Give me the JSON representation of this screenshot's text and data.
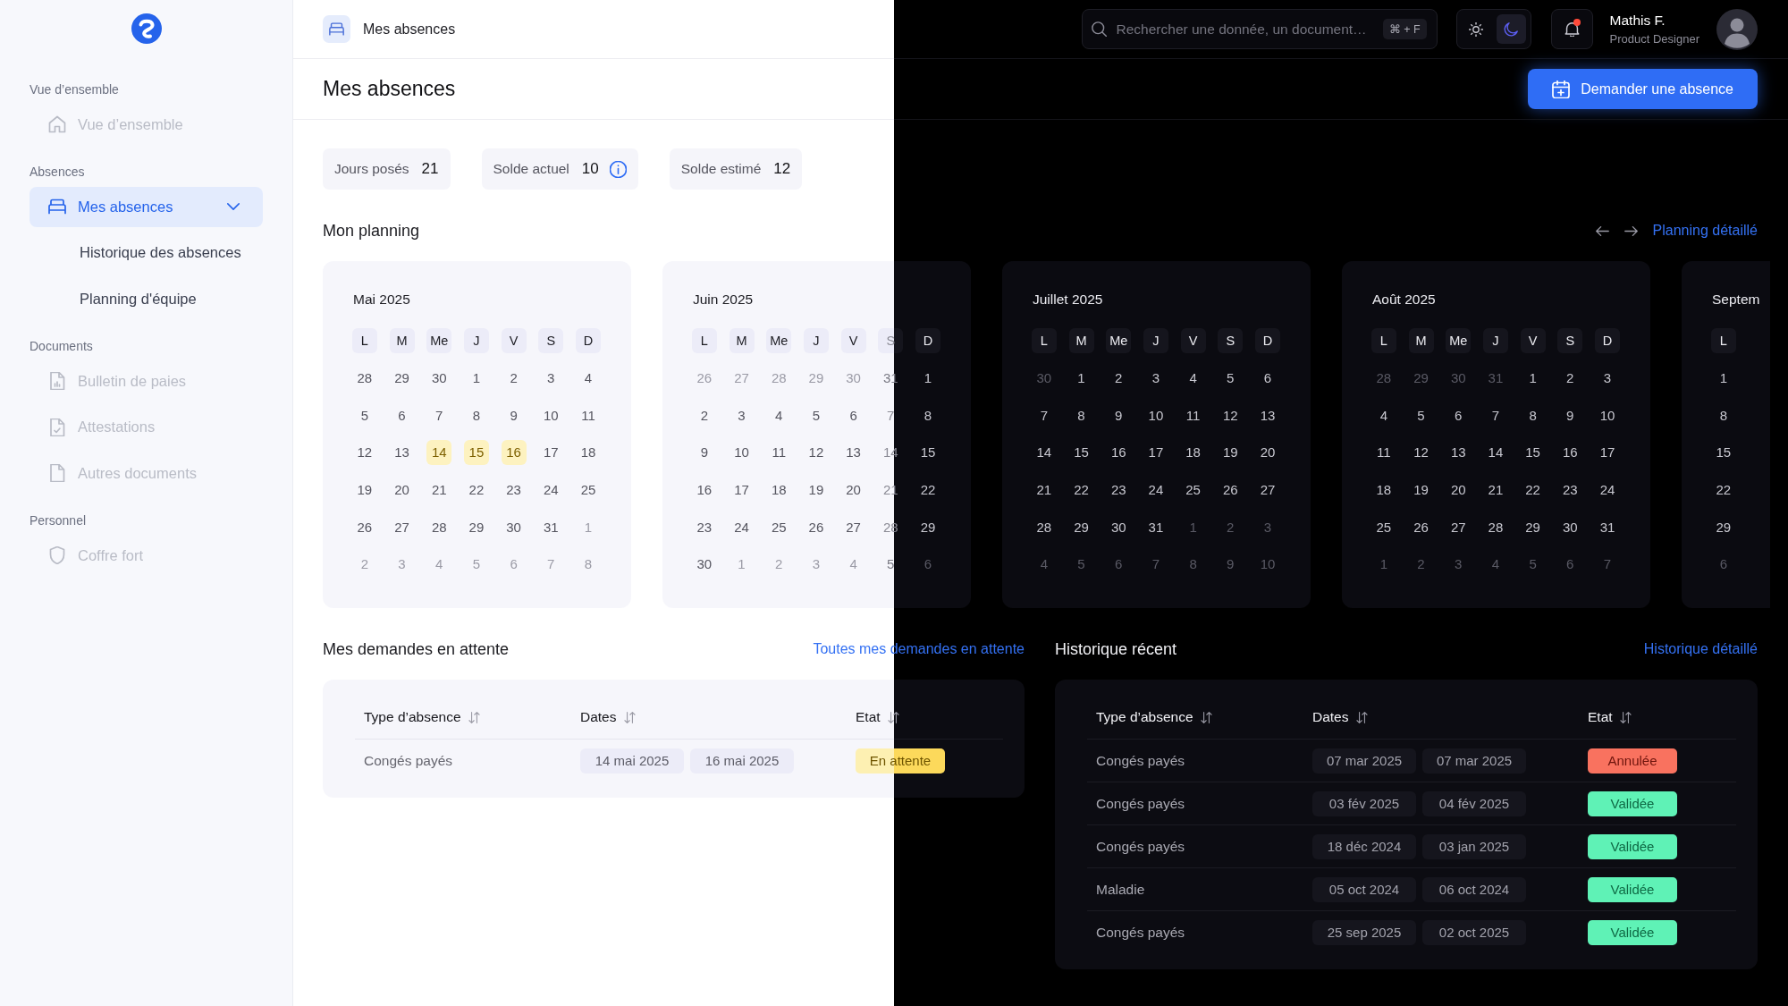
{
  "sidebar": {
    "sections": [
      {
        "label": "Vue d’ensemble",
        "items": [
          {
            "label": "Vue d’ensemble",
            "selected": false,
            "disabled": true
          }
        ]
      },
      {
        "label": "Absences",
        "items": [
          {
            "label": "Mes absences",
            "selected": true,
            "disabled": false,
            "expanded": true,
            "children": [
              {
                "label": "Historique des absences",
                "selected": false,
                "disabled": false
              },
              {
                "label": "Planning d'équipe",
                "selected": false,
                "disabled": false
              }
            ]
          }
        ]
      },
      {
        "label": "Documents",
        "items": [
          {
            "label": "Bulletin de paies",
            "selected": false,
            "disabled": true
          },
          {
            "label": "Attestations",
            "selected": false,
            "disabled": true
          },
          {
            "label": "Autres documents",
            "selected": false,
            "disabled": true
          }
        ]
      },
      {
        "label": "Personnel",
        "items": [
          {
            "label": "Coffre fort",
            "selected": false,
            "disabled": true
          }
        ]
      }
    ]
  },
  "header": {
    "breadcrumb": "Mes absences",
    "search": {
      "placeholder": "Rechercher une donnée, un document…",
      "shortcut": "⌘ + F"
    },
    "theme_toggle": {
      "options": [
        {
          "selected": false
        },
        {
          "selected": true
        }
      ]
    },
    "notifications": {
      "unread": true
    },
    "user": {
      "name": "Mathis F.",
      "role": "Product Designer"
    }
  },
  "page": {
    "title": "Mes absences",
    "primary_button": "Demander une absence"
  },
  "stats": [
    {
      "label": "Jours posés",
      "value": "21",
      "info": false
    },
    {
      "label": "Solde actuel",
      "value": "10",
      "info": true
    },
    {
      "label": "Solde estimé",
      "value": "12",
      "info": false
    }
  ],
  "planning": {
    "title": "Mon planning",
    "link": "Planning détaillé",
    "months": [
      {
        "title": "Mai 2025",
        "weekdays": [
          "L",
          "M",
          "Me",
          "J",
          "V",
          "S",
          "D"
        ],
        "weeks": [
          [
            {
              "day": "28",
              "dimmed": false,
              "absence": false
            },
            {
              "day": "29",
              "dimmed": false,
              "absence": false
            },
            {
              "day": "30",
              "dimmed": false,
              "absence": false
            },
            {
              "day": "1",
              "dimmed": false,
              "absence": false
            },
            {
              "day": "2",
              "dimmed": false,
              "absence": false
            },
            {
              "day": "3",
              "dimmed": false,
              "absence": false
            },
            {
              "day": "4",
              "dimmed": false,
              "absence": false
            }
          ],
          [
            {
              "day": "5",
              "dimmed": false,
              "absence": false
            },
            {
              "day": "6",
              "dimmed": false,
              "absence": false
            },
            {
              "day": "7",
              "dimmed": false,
              "absence": false
            },
            {
              "day": "8",
              "dimmed": false,
              "absence": false
            },
            {
              "day": "9",
              "dimmed": false,
              "absence": false
            },
            {
              "day": "10",
              "dimmed": false,
              "absence": false
            },
            {
              "day": "11",
              "dimmed": false,
              "absence": false
            }
          ],
          [
            {
              "day": "12",
              "dimmed": false,
              "absence": false
            },
            {
              "day": "13",
              "dimmed": false,
              "absence": false
            },
            {
              "day": "14",
              "dimmed": false,
              "absence": true
            },
            {
              "day": "15",
              "dimmed": false,
              "absence": true
            },
            {
              "day": "16",
              "dimmed": false,
              "absence": true
            },
            {
              "day": "17",
              "dimmed": false,
              "absence": false
            },
            {
              "day": "18",
              "dimmed": false,
              "absence": false
            }
          ],
          [
            {
              "day": "19",
              "dimmed": false,
              "absence": false
            },
            {
              "day": "20",
              "dimmed": false,
              "absence": false
            },
            {
              "day": "21",
              "dimmed": false,
              "absence": false
            },
            {
              "day": "22",
              "dimmed": false,
              "absence": false
            },
            {
              "day": "23",
              "dimmed": false,
              "absence": false
            },
            {
              "day": "24",
              "dimmed": false,
              "absence": false
            },
            {
              "day": "25",
              "dimmed": false,
              "absence": false
            }
          ],
          [
            {
              "day": "26",
              "dimmed": false,
              "absence": false
            },
            {
              "day": "27",
              "dimmed": false,
              "absence": false
            },
            {
              "day": "28",
              "dimmed": false,
              "absence": false
            },
            {
              "day": "29",
              "dimmed": false,
              "absence": false
            },
            {
              "day": "30",
              "dimmed": false,
              "absence": false
            },
            {
              "day": "31",
              "dimmed": false,
              "absence": false
            },
            {
              "day": "1",
              "dimmed": true,
              "absence": false
            }
          ],
          [
            {
              "day": "2",
              "dimmed": true,
              "absence": false
            },
            {
              "day": "3",
              "dimmed": true,
              "absence": false
            },
            {
              "day": "4",
              "dimmed": true,
              "absence": false
            },
            {
              "day": "5",
              "dimmed": true,
              "absence": false
            },
            {
              "day": "6",
              "dimmed": true,
              "absence": false
            },
            {
              "day": "7",
              "dimmed": true,
              "absence": false
            },
            {
              "day": "8",
              "dimmed": true,
              "absence": false
            }
          ]
        ]
      },
      {
        "title": "Juin 2025",
        "weekdays": [
          "L",
          "M",
          "Me",
          "J",
          "V",
          "S",
          "D"
        ],
        "weeks": [
          [
            {
              "day": "26",
              "dimmed": true,
              "absence": false
            },
            {
              "day": "27",
              "dimmed": true,
              "absence": false
            },
            {
              "day": "28",
              "dimmed": true,
              "absence": false
            },
            {
              "day": "29",
              "dimmed": true,
              "absence": false
            },
            {
              "day": "30",
              "dimmed": true,
              "absence": false
            },
            {
              "day": "31",
              "dimmed": true,
              "absence": false
            },
            {
              "day": "1",
              "dimmed": false,
              "absence": false
            }
          ],
          [
            {
              "day": "2",
              "dimmed": false,
              "absence": false
            },
            {
              "day": "3",
              "dimmed": false,
              "absence": false
            },
            {
              "day": "4",
              "dimmed": false,
              "absence": false
            },
            {
              "day": "5",
              "dimmed": false,
              "absence": false
            },
            {
              "day": "6",
              "dimmed": false,
              "absence": false
            },
            {
              "day": "7",
              "dimmed": false,
              "absence": false
            },
            {
              "day": "8",
              "dimmed": false,
              "absence": false
            }
          ],
          [
            {
              "day": "9",
              "dimmed": false,
              "absence": false
            },
            {
              "day": "10",
              "dimmed": false,
              "absence": false
            },
            {
              "day": "11",
              "dimmed": false,
              "absence": false
            },
            {
              "day": "12",
              "dimmed": false,
              "absence": false
            },
            {
              "day": "13",
              "dimmed": false,
              "absence": false
            },
            {
              "day": "14",
              "dimmed": false,
              "absence": false
            },
            {
              "day": "15",
              "dimmed": false,
              "absence": false
            }
          ],
          [
            {
              "day": "16",
              "dimmed": false,
              "absence": false
            },
            {
              "day": "17",
              "dimmed": false,
              "absence": false
            },
            {
              "day": "18",
              "dimmed": false,
              "absence": false
            },
            {
              "day": "19",
              "dimmed": false,
              "absence": false
            },
            {
              "day": "20",
              "dimmed": false,
              "absence": false
            },
            {
              "day": "21",
              "dimmed": false,
              "absence": false
            },
            {
              "day": "22",
              "dimmed": false,
              "absence": false
            }
          ],
          [
            {
              "day": "23",
              "dimmed": false,
              "absence": false
            },
            {
              "day": "24",
              "dimmed": false,
              "absence": false
            },
            {
              "day": "25",
              "dimmed": false,
              "absence": false
            },
            {
              "day": "26",
              "dimmed": false,
              "absence": false
            },
            {
              "day": "27",
              "dimmed": false,
              "absence": false
            },
            {
              "day": "28",
              "dimmed": false,
              "absence": false
            },
            {
              "day": "29",
              "dimmed": false,
              "absence": false
            }
          ],
          [
            {
              "day": "30",
              "dimmed": false,
              "absence": false
            },
            {
              "day": "1",
              "dimmed": true,
              "absence": false
            },
            {
              "day": "2",
              "dimmed": true,
              "absence": false
            },
            {
              "day": "3",
              "dimmed": true,
              "absence": false
            },
            {
              "day": "4",
              "dimmed": true,
              "absence": false
            },
            {
              "day": "5",
              "dimmed": true,
              "absence": false
            },
            {
              "day": "6",
              "dimmed": true,
              "absence": false
            }
          ]
        ]
      },
      {
        "title": "Juillet 2025",
        "weekdays": [
          "L",
          "M",
          "Me",
          "J",
          "V",
          "S",
          "D"
        ],
        "weeks": [
          [
            {
              "day": "30",
              "dimmed": true,
              "absence": false
            },
            {
              "day": "1",
              "dimmed": false,
              "absence": false
            },
            {
              "day": "2",
              "dimmed": false,
              "absence": false
            },
            {
              "day": "3",
              "dimmed": false,
              "absence": false
            },
            {
              "day": "4",
              "dimmed": false,
              "absence": false
            },
            {
              "day": "5",
              "dimmed": false,
              "absence": false
            },
            {
              "day": "6",
              "dimmed": false,
              "absence": false
            }
          ],
          [
            {
              "day": "7",
              "dimmed": false,
              "absence": false
            },
            {
              "day": "8",
              "dimmed": false,
              "absence": false
            },
            {
              "day": "9",
              "dimmed": false,
              "absence": false
            },
            {
              "day": "10",
              "dimmed": false,
              "absence": false
            },
            {
              "day": "11",
              "dimmed": false,
              "absence": false
            },
            {
              "day": "12",
              "dimmed": false,
              "absence": false
            },
            {
              "day": "13",
              "dimmed": false,
              "absence": false
            }
          ],
          [
            {
              "day": "14",
              "dimmed": false,
              "absence": false
            },
            {
              "day": "15",
              "dimmed": false,
              "absence": false
            },
            {
              "day": "16",
              "dimmed": false,
              "absence": false
            },
            {
              "day": "17",
              "dimmed": false,
              "absence": false
            },
            {
              "day": "18",
              "dimmed": false,
              "absence": false
            },
            {
              "day": "19",
              "dimmed": false,
              "absence": false
            },
            {
              "day": "20",
              "dimmed": false,
              "absence": false
            }
          ],
          [
            {
              "day": "21",
              "dimmed": false,
              "absence": false
            },
            {
              "day": "22",
              "dimmed": false,
              "absence": false
            },
            {
              "day": "23",
              "dimmed": false,
              "absence": false
            },
            {
              "day": "24",
              "dimmed": false,
              "absence": false
            },
            {
              "day": "25",
              "dimmed": false,
              "absence": false
            },
            {
              "day": "26",
              "dimmed": false,
              "absence": false
            },
            {
              "day": "27",
              "dimmed": false,
              "absence": false
            }
          ],
          [
            {
              "day": "28",
              "dimmed": false,
              "absence": false
            },
            {
              "day": "29",
              "dimmed": false,
              "absence": false
            },
            {
              "day": "30",
              "dimmed": false,
              "absence": false
            },
            {
              "day": "31",
              "dimmed": false,
              "absence": false
            },
            {
              "day": "1",
              "dimmed": true,
              "absence": false
            },
            {
              "day": "2",
              "dimmed": true,
              "absence": false
            },
            {
              "day": "3",
              "dimmed": true,
              "absence": false
            }
          ],
          [
            {
              "day": "4",
              "dimmed": true,
              "absence": false
            },
            {
              "day": "5",
              "dimmed": true,
              "absence": false
            },
            {
              "day": "6",
              "dimmed": true,
              "absence": false
            },
            {
              "day": "7",
              "dimmed": true,
              "absence": false
            },
            {
              "day": "8",
              "dimmed": true,
              "absence": false
            },
            {
              "day": "9",
              "dimmed": true,
              "absence": false
            },
            {
              "day": "10",
              "dimmed": true,
              "absence": false
            }
          ]
        ]
      },
      {
        "title": "Août 2025",
        "weekdays": [
          "L",
          "M",
          "Me",
          "J",
          "V",
          "S",
          "D"
        ],
        "weeks": [
          [
            {
              "day": "28",
              "dimmed": true,
              "absence": false
            },
            {
              "day": "29",
              "dimmed": true,
              "absence": false
            },
            {
              "day": "30",
              "dimmed": true,
              "absence": false
            },
            {
              "day": "31",
              "dimmed": true,
              "absence": false
            },
            {
              "day": "1",
              "dimmed": false,
              "absence": false
            },
            {
              "day": "2",
              "dimmed": false,
              "absence": false
            },
            {
              "day": "3",
              "dimmed": false,
              "absence": false
            }
          ],
          [
            {
              "day": "4",
              "dimmed": false,
              "absence": false
            },
            {
              "day": "5",
              "dimmed": false,
              "absence": false
            },
            {
              "day": "6",
              "dimmed": false,
              "absence": false
            },
            {
              "day": "7",
              "dimmed": false,
              "absence": false
            },
            {
              "day": "8",
              "dimmed": false,
              "absence": false
            },
            {
              "day": "9",
              "dimmed": false,
              "absence": false
            },
            {
              "day": "10",
              "dimmed": false,
              "absence": false
            }
          ],
          [
            {
              "day": "11",
              "dimmed": false,
              "absence": false
            },
            {
              "day": "12",
              "dimmed": false,
              "absence": false
            },
            {
              "day": "13",
              "dimmed": false,
              "absence": false
            },
            {
              "day": "14",
              "dimmed": false,
              "absence": false
            },
            {
              "day": "15",
              "dimmed": false,
              "absence": false
            },
            {
              "day": "16",
              "dimmed": false,
              "absence": false
            },
            {
              "day": "17",
              "dimmed": false,
              "absence": false
            }
          ],
          [
            {
              "day": "18",
              "dimmed": false,
              "absence": false
            },
            {
              "day": "19",
              "dimmed": false,
              "absence": false
            },
            {
              "day": "20",
              "dimmed": false,
              "absence": false
            },
            {
              "day": "21",
              "dimmed": false,
              "absence": false
            },
            {
              "day": "22",
              "dimmed": false,
              "absence": false
            },
            {
              "day": "23",
              "dimmed": false,
              "absence": false
            },
            {
              "day": "24",
              "dimmed": false,
              "absence": false
            }
          ],
          [
            {
              "day": "25",
              "dimmed": false,
              "absence": false
            },
            {
              "day": "26",
              "dimmed": false,
              "absence": false
            },
            {
              "day": "27",
              "dimmed": false,
              "absence": false
            },
            {
              "day": "28",
              "dimmed": false,
              "absence": false
            },
            {
              "day": "29",
              "dimmed": false,
              "absence": false
            },
            {
              "day": "30",
              "dimmed": false,
              "absence": false
            },
            {
              "day": "31",
              "dimmed": false,
              "absence": false
            }
          ],
          [
            {
              "day": "1",
              "dimmed": true,
              "absence": false
            },
            {
              "day": "2",
              "dimmed": true,
              "absence": false
            },
            {
              "day": "3",
              "dimmed": true,
              "absence": false
            },
            {
              "day": "4",
              "dimmed": true,
              "absence": false
            },
            {
              "day": "5",
              "dimmed": true,
              "absence": false
            },
            {
              "day": "6",
              "dimmed": true,
              "absence": false
            },
            {
              "day": "7",
              "dimmed": true,
              "absence": false
            }
          ]
        ]
      },
      {
        "title": "Septem",
        "weekdays": [
          "L"
        ],
        "weeks": [
          [
            {
              "day": "1",
              "dimmed": false,
              "absence": false
            }
          ],
          [
            {
              "day": "8",
              "dimmed": false,
              "absence": false
            }
          ],
          [
            {
              "day": "15",
              "dimmed": false,
              "absence": false
            }
          ],
          [
            {
              "day": "22",
              "dimmed": false,
              "absence": false
            }
          ],
          [
            {
              "day": "29",
              "dimmed": false,
              "absence": false
            }
          ],
          [
            {
              "day": "6",
              "dimmed": true,
              "absence": false
            }
          ]
        ]
      }
    ]
  },
  "pending": {
    "title": "Mes demandes en attente",
    "link": "Toutes mes demandes en attente",
    "columns": [
      "Type d’absence",
      "Dates",
      "Etat"
    ],
    "rows": [
      {
        "type": "Congés payés",
        "start": "14 mai 2025",
        "end": "16 mai 2025",
        "status": {
          "label": "En attente",
          "kind": "pending"
        }
      }
    ]
  },
  "history": {
    "title": "Historique récent",
    "link": "Historique détaillé",
    "columns": [
      "Type d’absence",
      "Dates",
      "Etat"
    ],
    "rows": [
      {
        "type": "Congés payés",
        "start": "07 mar 2025",
        "end": "07 mar 2025",
        "status": {
          "label": "Annulée",
          "kind": "cancelled"
        }
      },
      {
        "type": "Congés payés",
        "start": "03 fév 2025",
        "end": "04 fév 2025",
        "status": {
          "label": "Validée",
          "kind": "approved"
        }
      },
      {
        "type": "Congés payés",
        "start": "18 déc 2024",
        "end": "03 jan 2025",
        "status": {
          "label": "Validée",
          "kind": "approved"
        }
      },
      {
        "type": "Maladie",
        "start": "05 oct 2024",
        "end": "06 oct 2024",
        "status": {
          "label": "Validée",
          "kind": "approved"
        }
      },
      {
        "type": "Congés payés",
        "start": "25 sep 2025",
        "end": "02 oct 2025",
        "status": {
          "label": "Validée",
          "kind": "approved"
        }
      }
    ]
  }
}
